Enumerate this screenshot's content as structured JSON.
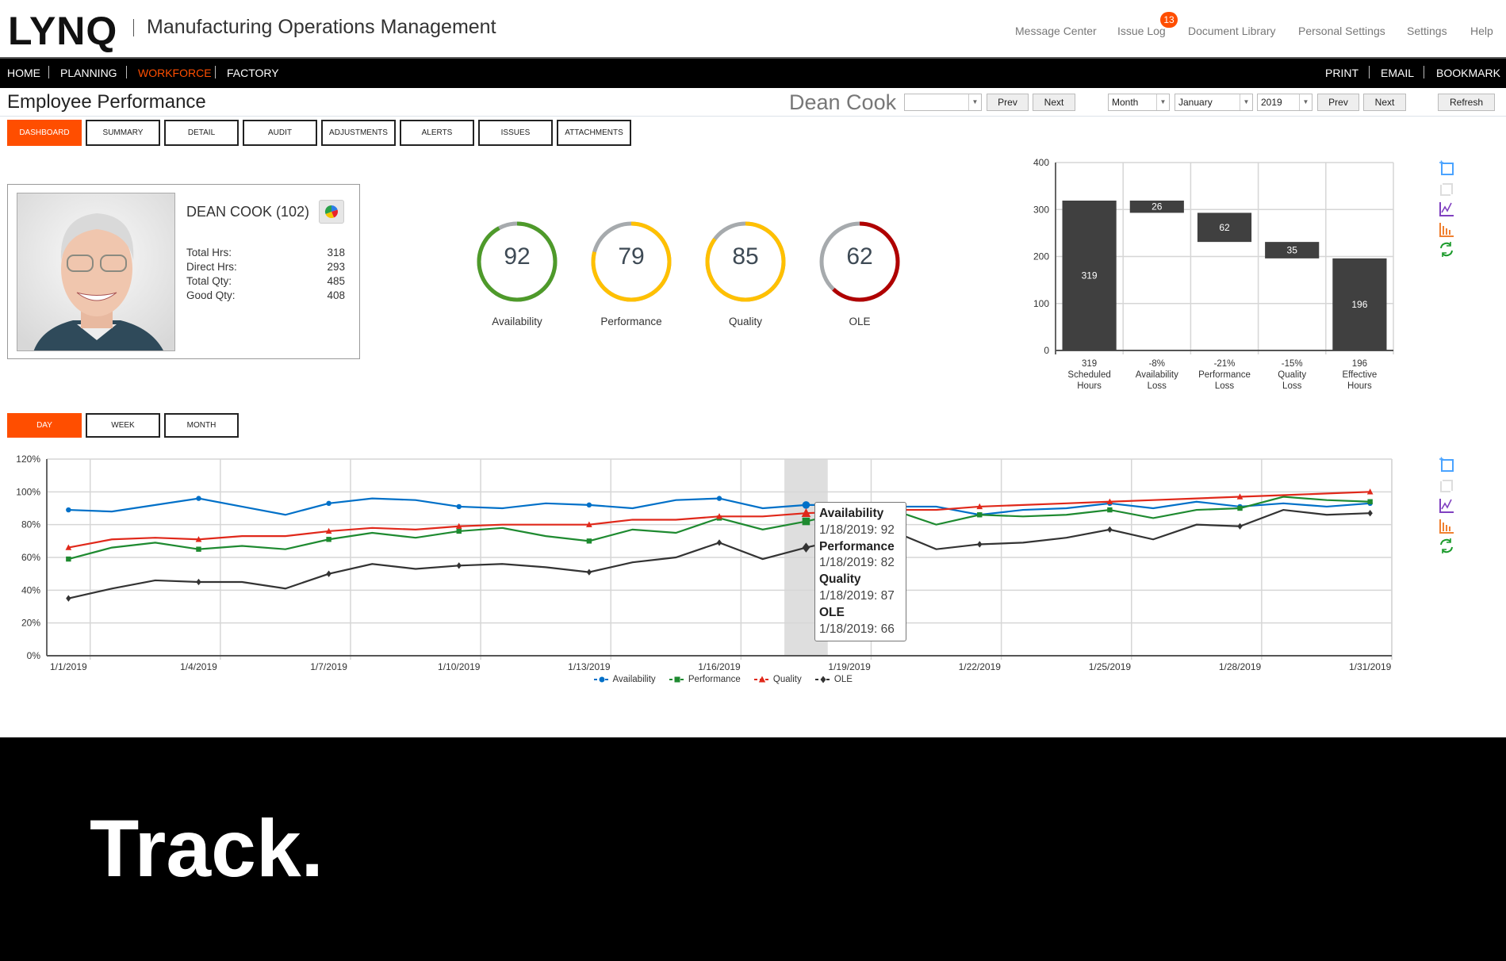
{
  "app": {
    "logo": "LYNQ",
    "title": "Manufacturing Operations Management"
  },
  "top_links": [
    {
      "label": "Message Center"
    },
    {
      "label": "Issue Log",
      "badge": "13"
    },
    {
      "label": "Document Library"
    },
    {
      "label": "Personal Settings"
    },
    {
      "label": "Settings"
    },
    {
      "label": "Help"
    }
  ],
  "nav": {
    "left": [
      "HOME",
      "PLANNING",
      "WORKFORCE",
      "FACTORY"
    ],
    "active": "WORKFORCE",
    "right": [
      "PRINT",
      "EMAIL",
      "BOOKMARK"
    ]
  },
  "page": {
    "title": "Employee Performance",
    "employee_name": "Dean Cook"
  },
  "controls": {
    "employee_select": "",
    "prev": "Prev",
    "next": "Next",
    "period_type": "Month",
    "month": "January",
    "year": "2019",
    "prev2": "Prev",
    "next2": "Next",
    "refresh": "Refresh"
  },
  "tabs": [
    "DASHBOARD",
    "SUMMARY",
    "DETAIL",
    "AUDIT",
    "ADJUSTMENTS",
    "ALERTS",
    "ISSUES",
    "ATTACHMENTS"
  ],
  "active_tab": "DASHBOARD",
  "employee": {
    "name": "DEAN COOK (102)",
    "stats": [
      {
        "label": "Total Hrs:",
        "value": "318"
      },
      {
        "label": "Direct Hrs:",
        "value": "293"
      },
      {
        "label": "Total Qty:",
        "value": "485"
      },
      {
        "label": "Good Qty:",
        "value": "408"
      }
    ]
  },
  "gauges": [
    {
      "label": "Availability",
      "value": 92,
      "color": "#4e9a2a"
    },
    {
      "label": "Performance",
      "value": 79,
      "color": "#ffc000"
    },
    {
      "label": "Quality",
      "value": 85,
      "color": "#ffc000"
    },
    {
      "label": "OLE",
      "value": 62,
      "color": "#b00000"
    }
  ],
  "period_tabs": [
    "DAY",
    "WEEK",
    "MONTH"
  ],
  "active_period": "DAY",
  "chart_data": [
    {
      "type": "bar",
      "subtype": "waterfall",
      "categories": [
        [
          "319",
          "Scheduled",
          "Hours"
        ],
        [
          "-8%",
          "Availability",
          "Loss"
        ],
        [
          "-21%",
          "Performance",
          "Loss"
        ],
        [
          "-15%",
          "Quality",
          "Loss"
        ],
        [
          "196",
          "Effective",
          "Hours"
        ]
      ],
      "bars": [
        {
          "start": 0,
          "end": 319,
          "label": "319"
        },
        {
          "start": 293,
          "end": 319,
          "label": "26"
        },
        {
          "start": 231,
          "end": 293,
          "label": "62"
        },
        {
          "start": 196,
          "end": 231,
          "label": "35"
        },
        {
          "start": 0,
          "end": 196,
          "label": "196"
        }
      ],
      "ylim": [
        0,
        400
      ],
      "yticks": [
        "0",
        "100",
        "200",
        "300",
        "400"
      ],
      "grid": true,
      "bar_color": "#404040"
    },
    {
      "type": "line",
      "x": [
        "1/1/2019",
        "1/2/2019",
        "1/3/2019",
        "1/4/2019",
        "1/5/2019",
        "1/6/2019",
        "1/7/2019",
        "1/8/2019",
        "1/9/2019",
        "1/10/2019",
        "1/11/2019",
        "1/12/2019",
        "1/13/2019",
        "1/14/2019",
        "1/15/2019",
        "1/16/2019",
        "1/17/2019",
        "1/18/2019",
        "1/19/2019",
        "1/20/2019",
        "1/21/2019",
        "1/22/2019",
        "1/23/2019",
        "1/24/2019",
        "1/25/2019",
        "1/26/2019",
        "1/27/2019",
        "1/28/2019",
        "1/29/2019",
        "1/30/2019",
        "1/31/2019"
      ],
      "xticks": [
        "1/1/2019",
        "1/4/2019",
        "1/7/2019",
        "1/10/2019",
        "1/13/2019",
        "1/16/2019",
        "1/19/2019",
        "1/22/2019",
        "1/25/2019",
        "1/28/2019",
        "1/31/2019"
      ],
      "ylim": [
        0,
        120
      ],
      "yticks": [
        "0%",
        "20%",
        "40%",
        "60%",
        "80%",
        "100%",
        "120%"
      ],
      "grid": true,
      "legend": "bottom",
      "highlight": "1/18/2019",
      "series": [
        {
          "name": "Availability",
          "color": "#0070c8",
          "marker": "circle",
          "values": [
            89,
            88,
            92,
            96,
            91,
            86,
            93,
            96,
            95,
            91,
            90,
            93,
            92,
            90,
            95,
            96,
            90,
            92,
            92,
            91,
            91,
            86,
            89,
            90,
            93,
            90,
            94,
            91,
            93,
            91,
            93
          ]
        },
        {
          "name": "Performance",
          "color": "#1e8a30",
          "marker": "square",
          "values": [
            59,
            66,
            69,
            65,
            67,
            65,
            71,
            75,
            72,
            76,
            78,
            73,
            70,
            77,
            75,
            84,
            77,
            82,
            88,
            89,
            80,
            86,
            85,
            86,
            89,
            84,
            89,
            90,
            97,
            95,
            94
          ]
        },
        {
          "name": "Quality",
          "color": "#e0281a",
          "marker": "triangle",
          "values": [
            66,
            71,
            72,
            71,
            73,
            73,
            76,
            78,
            77,
            79,
            80,
            80,
            80,
            83,
            83,
            85,
            85,
            87,
            88,
            89,
            89,
            91,
            92,
            93,
            94,
            95,
            96,
            97,
            98,
            99,
            100
          ]
        },
        {
          "name": "OLE",
          "color": "#333333",
          "marker": "diamond",
          "values": [
            35,
            41,
            46,
            45,
            45,
            41,
            50,
            56,
            53,
            55,
            56,
            54,
            51,
            57,
            60,
            69,
            59,
            66,
            72,
            76,
            65,
            68,
            69,
            72,
            77,
            71,
            80,
            79,
            89,
            86,
            87
          ]
        }
      ],
      "tooltip": [
        {
          "series": "Availability",
          "text": "1/18/2019: 92"
        },
        {
          "series": "Performance",
          "text": "1/18/2019: 82"
        },
        {
          "series": "Quality",
          "text": "1/18/2019: 87"
        },
        {
          "series": "OLE",
          "text": "1/18/2019: 66"
        }
      ]
    }
  ],
  "chart_tools": [
    "zoom-icon",
    "reset-zoom-icon",
    "line-chart-icon",
    "bar-chart-icon",
    "refresh-icon"
  ],
  "footer": {
    "tagline": "Track."
  }
}
